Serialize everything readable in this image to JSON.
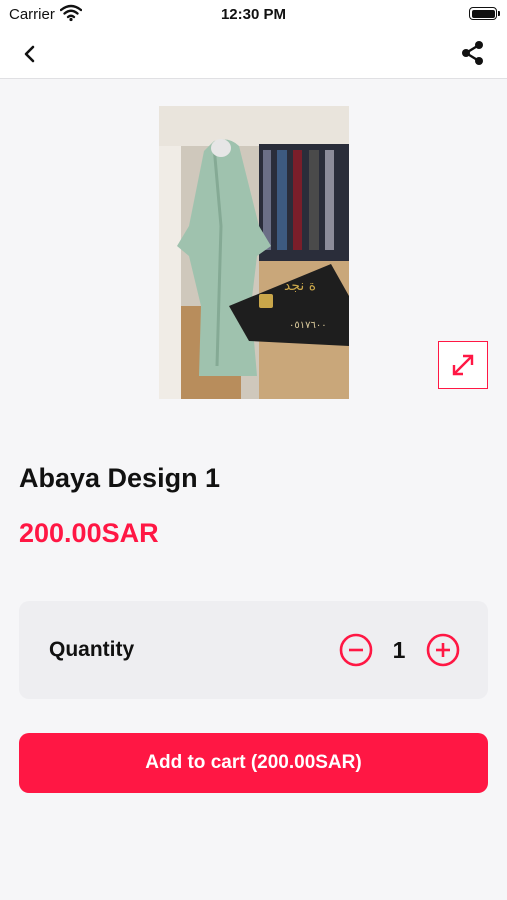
{
  "status_bar": {
    "carrier": "Carrier",
    "time": "12:30 PM"
  },
  "nav": {
    "back_icon": "chevron-left-icon",
    "share_icon": "share-icon"
  },
  "product": {
    "title": "Abaya Design 1",
    "price": "200.00SAR",
    "image_alt": "Green abaya on mannequin with store card",
    "expand_icon": "expand-diagonal-icon"
  },
  "quantity": {
    "label": "Quantity",
    "value": "1",
    "minus_icon": "minus-circle-icon",
    "plus_icon": "plus-circle-icon"
  },
  "cart": {
    "add_label": "Add to cart (200.00SAR)"
  },
  "colors": {
    "accent": "#ff1744",
    "background": "#f6f6f8",
    "card": "#eeeef1"
  }
}
